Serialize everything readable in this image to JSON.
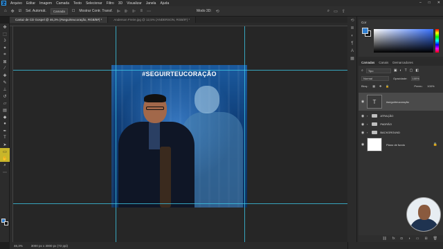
{
  "app": {
    "logo": "Ps"
  },
  "menu": [
    "Arquivo",
    "Editar",
    "Imagem",
    "Camada",
    "Texto",
    "Selecionar",
    "Filtro",
    "3D",
    "Visualizar",
    "Janela",
    "Ajuda"
  ],
  "options_bar": {
    "auto_select_label": "Sel. Automát.",
    "auto_select_target": "Camada",
    "transform_label": "Mostrar Contr. Transf.",
    "mode_3d": "Modo 3D:"
  },
  "tabs": [
    {
      "label": "Cartaz de CD Gospel @ 46,3% (#seguirteucoração, RGB/8#) *",
      "active": true
    },
    {
      "label": "Anderson Freire.jpg @ 12,5% (ANDERSON, RGB/8*) *",
      "active": false
    }
  ],
  "canvas": {
    "headline": "#SEGUIRTEUCORAÇÃO"
  },
  "color_panel": {
    "title": "Cor",
    "fg": "#2f7fd1",
    "bg": "#111111"
  },
  "layers_panel": {
    "tabs": [
      "Camadas",
      "Canais",
      "Demarcadores"
    ],
    "kind": "Tipo",
    "blend": "Normal",
    "opacity_label": "Opacidade:",
    "opacity": "100%",
    "lock_label": "Bloq.:",
    "fill_label": "Preen.:",
    "fill": "100%",
    "layers": [
      {
        "name": "#seguirteucoração",
        "type": "text"
      },
      {
        "name": "ATRAÇÃO",
        "type": "group"
      },
      {
        "name": "PADRÃO",
        "type": "group"
      },
      {
        "name": "BACKGROUND",
        "type": "group"
      },
      {
        "name": "Plano de fundo",
        "type": "image"
      }
    ]
  },
  "status": {
    "zoom": "46,3%",
    "size": "3000 px x 3000 px (72 ppi)"
  }
}
